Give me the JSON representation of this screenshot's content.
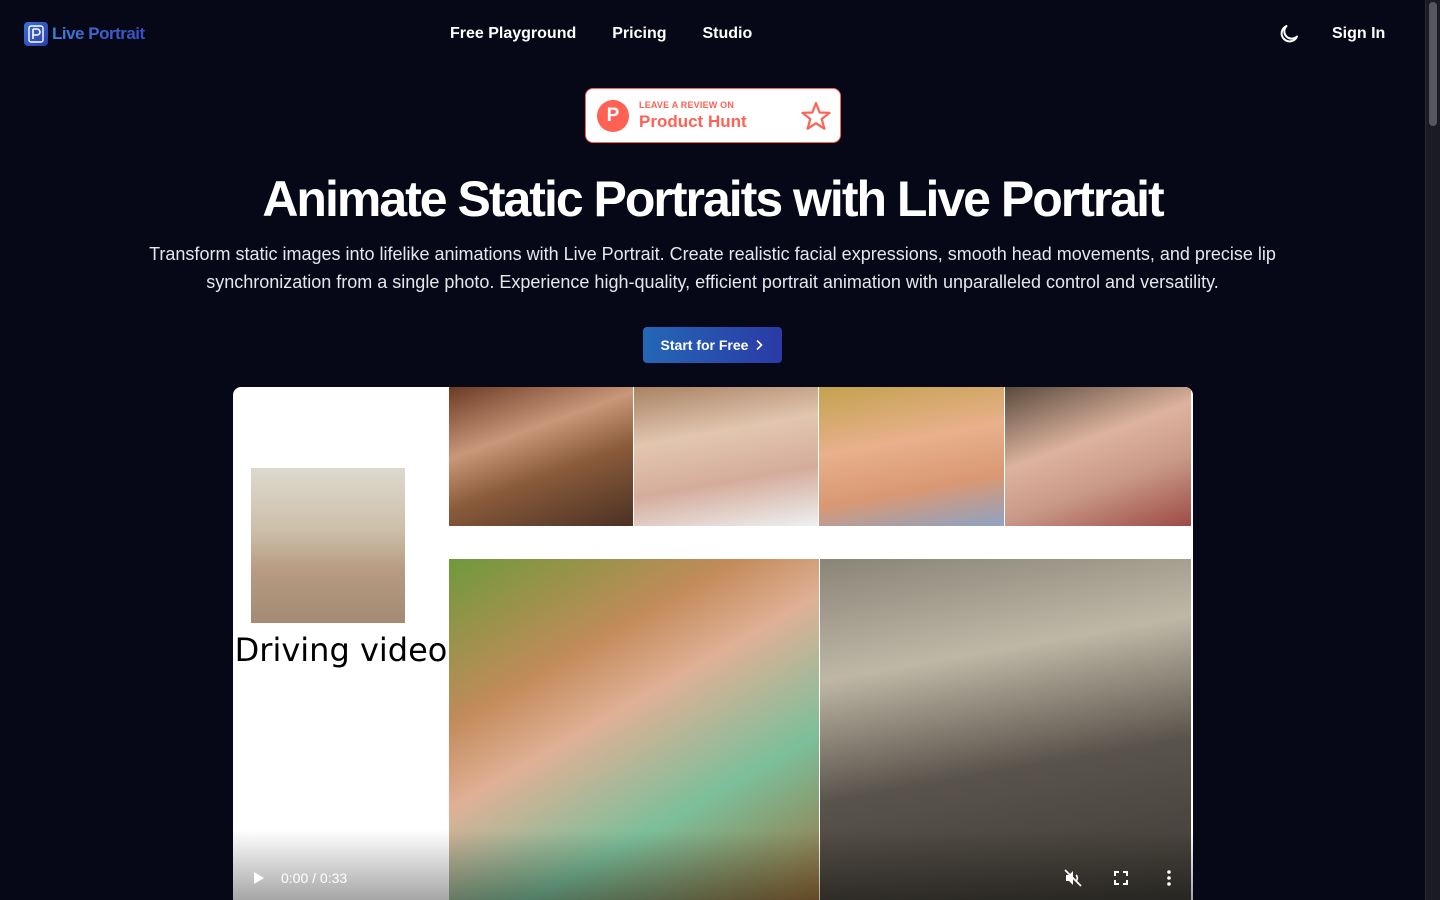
{
  "header": {
    "logo_text": "Live Portrait",
    "nav": [
      {
        "label": "Free Playground"
      },
      {
        "label": "Pricing"
      },
      {
        "label": "Studio"
      }
    ],
    "theme_icon": "moon-icon",
    "sign_in": "Sign In"
  },
  "badge": {
    "small": "LEAVE A REVIEW ON",
    "big": "Product Hunt",
    "logo_letter": "P",
    "icon": "star-icon"
  },
  "hero": {
    "title": "Animate Static Portraits with Live Portrait",
    "subtitle": "Transform static images into lifelike animations with Live Portrait. Create realistic facial expressions, smooth head movements, and precise lip synchronization from a single photo. Experience high-quality, efficient portrait animation with unparalleled control and versatility.",
    "cta": "Start for Free"
  },
  "video": {
    "driving_label": "Driving video",
    "time": "0:00 / 0:33"
  },
  "colors": {
    "background": "#070817",
    "accent": "#2467b6",
    "product_hunt": "#ff6154"
  }
}
